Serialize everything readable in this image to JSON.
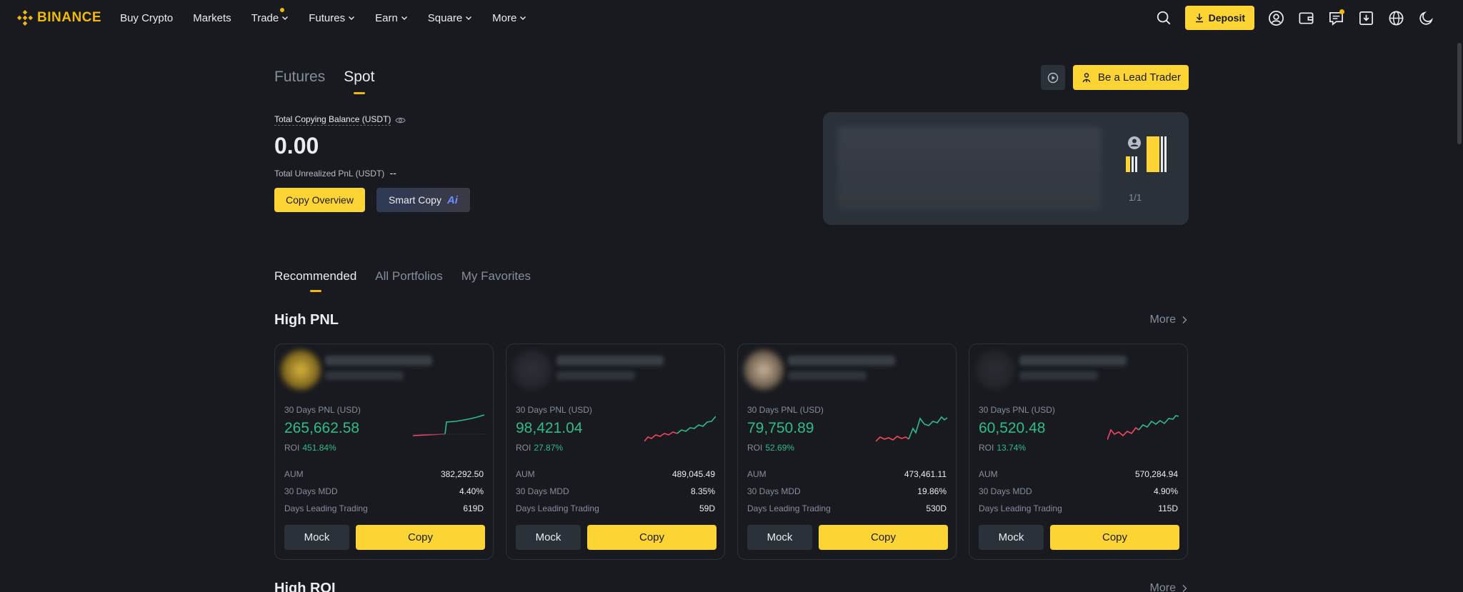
{
  "nav": {
    "logo_text": "BINANCE",
    "items": [
      {
        "label": "Buy Crypto",
        "has_chevron": false
      },
      {
        "label": "Markets",
        "has_chevron": false
      },
      {
        "label": "Trade",
        "has_chevron": true
      },
      {
        "label": "Futures",
        "has_chevron": true
      },
      {
        "label": "Earn",
        "has_chevron": true
      },
      {
        "label": "Square",
        "has_chevron": true
      },
      {
        "label": "More",
        "has_chevron": true
      }
    ],
    "deposit_label": "Deposit",
    "icons": [
      "search-icon",
      "user-icon",
      "wallet-icon",
      "message-icon",
      "download-icon",
      "globe-icon",
      "moon-icon"
    ]
  },
  "mode_tabs": [
    {
      "label": "Futures",
      "active": false
    },
    {
      "label": "Spot",
      "active": true
    }
  ],
  "lead_trader_label": "Be a Lead Trader",
  "balance": {
    "label": "Total Copying Balance (USDT)",
    "value": "0.00",
    "pnl_label": "Total Unrealized PnL (USDT)",
    "pnl_value": "--"
  },
  "buttons": {
    "copy_overview": "Copy Overview",
    "smart_copy": "Smart Copy",
    "smart_copy_badge": "Ai"
  },
  "banner": {
    "page_indicator": "1/1"
  },
  "section_tabs": [
    {
      "label": "Recommended",
      "active": true
    },
    {
      "label": "All Portfolios",
      "active": false
    },
    {
      "label": "My Favorites",
      "active": false
    }
  ],
  "high_pnl": {
    "title": "High PNL",
    "more_label": "More"
  },
  "high_roi": {
    "title": "High ROI",
    "more_label": "More"
  },
  "card_labels": {
    "pnl": "30 Days PNL (USD)",
    "roi": "ROI",
    "aum": "AUM",
    "mdd": "30 Days MDD",
    "days": "Days Leading Trading",
    "mock": "Mock",
    "copy": "Copy"
  },
  "cards": [
    {
      "pnl": "265,662.58",
      "roi": "451.84%",
      "aum": "382,292.50",
      "mdd": "4.40%",
      "days": "619D"
    },
    {
      "pnl": "98,421.04",
      "roi": "27.87%",
      "aum": "489,045.49",
      "mdd": "8.35%",
      "days": "59D"
    },
    {
      "pnl": "79,750.89",
      "roi": "52.69%",
      "aum": "473,461.11",
      "mdd": "19.86%",
      "days": "530D"
    },
    {
      "pnl": "60,520.48",
      "roi": "13.74%",
      "aum": "570,284.94",
      "mdd": "4.90%",
      "days": "115D"
    }
  ],
  "colors": {
    "background": "#181a20",
    "accent": "#fcd535",
    "brand": "#f0b90b",
    "positive": "#2ebd85",
    "negative": "#f6465d",
    "muted": "#848e9c"
  }
}
